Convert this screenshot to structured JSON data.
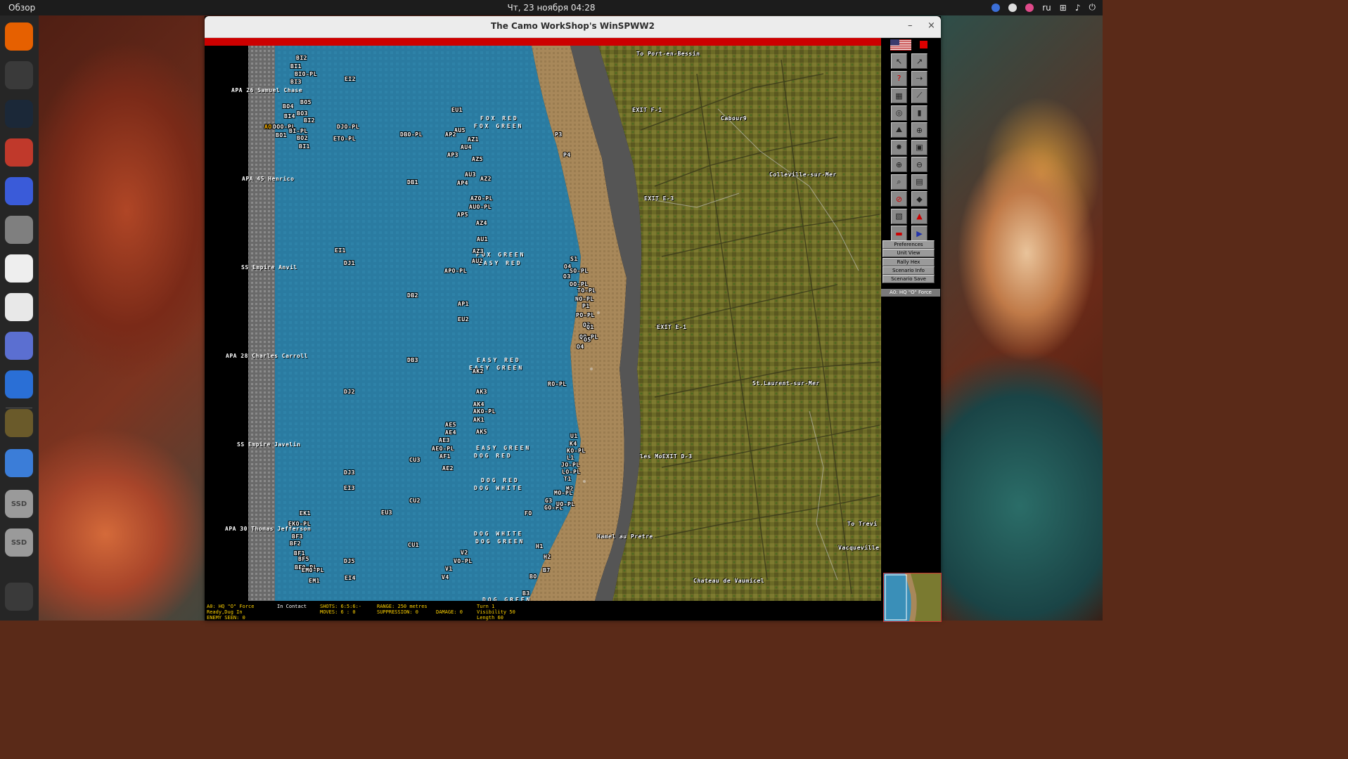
{
  "topbar": {
    "activities": "Обзор",
    "clock": "Чт, 23 ноября  04:28",
    "lang": "ru"
  },
  "dock": [
    {
      "name": "firefox-icon",
      "color": "#e66000"
    },
    {
      "name": "terminal-icon",
      "color": "#3a3a3a"
    },
    {
      "name": "steam-icon",
      "color": "#1b2838"
    },
    {
      "name": "files-icon",
      "color": "#c0392b"
    },
    {
      "name": "krita-icon",
      "color": "#3a5bd9"
    },
    {
      "name": "image-viewer-icon",
      "color": "#7f7f7f"
    },
    {
      "name": "inkscape-icon",
      "color": "#eeeeee"
    },
    {
      "name": "libreoffice-math-icon",
      "color": "#e8e8e8"
    },
    {
      "name": "freecad-icon",
      "color": "#5b6fd1"
    },
    {
      "name": "libreoffice-writer-icon",
      "color": "#2a6fd6"
    },
    {
      "name": "winspww2-icon",
      "color": "#6a5a2a"
    },
    {
      "name": "qbittorrent-icon",
      "color": "#3b7dd8"
    },
    {
      "name": "ssd-drive-icon",
      "color": "#9a9a9a",
      "label": "SSD"
    },
    {
      "name": "ssd-drive-icon",
      "color": "#9a9a9a",
      "label": "SSD"
    },
    {
      "name": "app-grid-icon",
      "color": "#3a3a3a"
    }
  ],
  "window": {
    "title": "The Camo WorkShop's WinSPWW2",
    "minimize": "–",
    "close": "×"
  },
  "map": {
    "ships": [
      {
        "id": "apa26",
        "text": "APA 26 Samuel Chase"
      },
      {
        "id": "apa45",
        "text": "APA 45 Henrico"
      },
      {
        "id": "anvil",
        "text": "SS Empire Anvil"
      },
      {
        "id": "apa28",
        "text": "APA 28 Charles Carroll"
      },
      {
        "id": "javelin",
        "text": "SS Empire Javelin"
      },
      {
        "id": "apa30",
        "text": "APA 30 Thomas Jefferson"
      }
    ],
    "beaches": [
      {
        "id": "fox-red",
        "text": "FOX RED"
      },
      {
        "id": "fox-green",
        "text": "FOX GREEN"
      },
      {
        "id": "fox-green2",
        "text": "FOX GREEN"
      },
      {
        "id": "easy-red",
        "text": "EASY RED"
      },
      {
        "id": "easy-red2",
        "text": "EASY RED"
      },
      {
        "id": "easy-green",
        "text": "EASY GREEN"
      },
      {
        "id": "easy-green2",
        "text": "EASY GREEN"
      },
      {
        "id": "dog-red",
        "text": "DOG RED"
      },
      {
        "id": "dog-red2",
        "text": "DOG RED"
      },
      {
        "id": "dog-white",
        "text": "DOG WHITE"
      },
      {
        "id": "dog-white2",
        "text": "DOG WHITE"
      },
      {
        "id": "dog-green",
        "text": "DOG GREEN"
      },
      {
        "id": "dog-green2",
        "text": "DOG GREEN"
      }
    ],
    "towns": [
      {
        "id": "port",
        "text": "To Port-en-Bessin"
      },
      {
        "id": "exitf1",
        "text": "EXIT F-1"
      },
      {
        "id": "cabourg",
        "text": "Cabour9"
      },
      {
        "id": "colleville",
        "text": "Colleville-sur-Mer"
      },
      {
        "id": "exite3",
        "text": "EXIT E-3"
      },
      {
        "id": "exite1",
        "text": "EXIT E-1"
      },
      {
        "id": "stlaurent",
        "text": "St.Laurent-sur-Mer"
      },
      {
        "id": "lesmoulins",
        "text": "les MoEXIT D-3"
      },
      {
        "id": "totrevi",
        "text": "To Trevi"
      },
      {
        "id": "vacqueville",
        "text": "Vacqueville"
      },
      {
        "id": "hamel",
        "text": "Hamel au Pretre"
      },
      {
        "id": "chateau",
        "text": "Chateau de Vaumicel"
      }
    ],
    "units": [
      "BI2",
      "BI1",
      "BIO-PL",
      "BI3",
      "EI2",
      "BO5",
      "BO4",
      "BO3",
      "BI2",
      "DOO-PL",
      "BI-PL",
      "BO1",
      "BO2",
      "DJO-PL",
      "DBO-PL",
      "BI4",
      "BI1",
      "ETO-PL",
      "EU1",
      "AU5",
      "AP2",
      "AZ1",
      "AU4",
      "AP3",
      "AZ5",
      "P3",
      "P4",
      "DB1",
      "AU3",
      "AZ2",
      "AP4",
      "AZO-PL",
      "AUO-PL",
      "AP5",
      "AZ4",
      "AU1",
      "EI1",
      "DJ1",
      "AZ3",
      "AU2",
      "APO-PL",
      "S1",
      "O4",
      "SO-PL",
      "O3",
      "OO-PL",
      "TO-PL",
      "NO-PL",
      "P1",
      "PO-PL",
      "O2",
      "Q1",
      "QO-PL",
      "O5",
      "O4",
      "DB2",
      "AP1",
      "EU2",
      "DB3",
      "AK2",
      "RO-PL",
      "DJ2",
      "AK3",
      "AK4",
      "AKO-PL",
      "AK1",
      "AE5",
      "AE4",
      "AK5",
      "AE3",
      "AEO-PL",
      "AF1",
      "CU3",
      "AE2",
      "U1",
      "K4",
      "KO-PL",
      "L1",
      "JO-PL",
      "LO-PL",
      "T1",
      "M2",
      "MO-PL",
      "DJ3",
      "EI3",
      "CU2",
      "G3",
      "GO-PL",
      "UO-PL",
      "FO",
      "EK1",
      "EU3",
      "EKO-PL",
      "BF3",
      "BF2",
      "CU1",
      "V2",
      "VO-PL",
      "H1",
      "H2",
      "BF1",
      "BF5",
      "BEO-PL",
      "EMO-PL",
      "DJ5",
      "V1",
      "V4",
      "B7",
      "BO",
      "EI4",
      "EM1",
      "B3",
      "GHO-PL",
      "AO"
    ]
  },
  "sidepanel": {
    "tool_icons": [
      "move-left-icon",
      "move-right-icon",
      "question-icon",
      "next-unit-icon",
      "deploy-icon",
      "signal-icon",
      "target-icon",
      "radio-icon",
      "terrain-icon",
      "hq-icon",
      "artillery-icon",
      "smoke-icon",
      "zoom-in-icon",
      "zoom-out-icon",
      "search-icon",
      "notes-icon",
      "cancel-icon",
      "vehicle-icon",
      "report-icon",
      "up-arrow-icon",
      "save-icon",
      "end-turn-icon"
    ],
    "menu": [
      "Preferences",
      "Unit View",
      "Rally Hex",
      "Scenario Info",
      "Scenario Save"
    ],
    "selected_unit": "A0: HQ \"O\" Force"
  },
  "status": {
    "unit": "A0:  HQ \"O\" Force",
    "state": "Ready,Dug In",
    "enemy_seen": "ENEMY SEEN: 0",
    "contact": "In Contact",
    "shots": "SHOTS: 6:5:6:-",
    "moves": "MOVES: 6  :  0",
    "range": "RANGE: 250 metres",
    "suppression": "SUPPRESSION: 0",
    "damage": "DAMAGE:  0",
    "turn": "Turn 1",
    "visibility": "Visibility 50",
    "length": "Length 60"
  }
}
